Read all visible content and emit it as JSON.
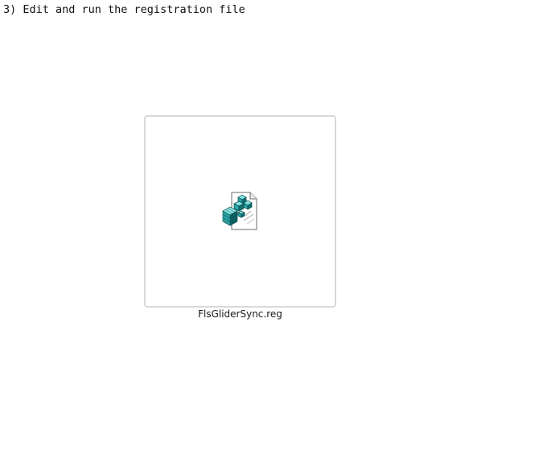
{
  "instructions": {
    "step_heading": "3) Edit and run the registration file"
  },
  "attachment": {
    "icon": "registry-file-icon",
    "file_name": "FlsGliderSync.reg"
  }
}
